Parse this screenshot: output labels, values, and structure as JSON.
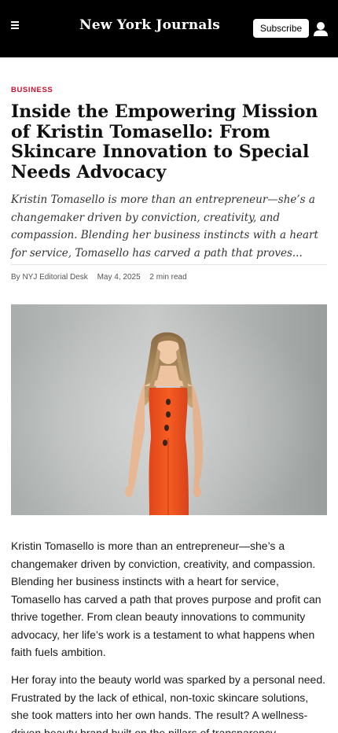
{
  "header": {
    "logo": "New York Journals",
    "subscribe_label": "Subscribe",
    "menu_icon": "hamburger-menu-icon",
    "user_icon": "user-icon"
  },
  "article": {
    "category": "BUSINESS",
    "headline": "Inside the Empowering Mission of Kristin Tomasello: From Skincare Innovation to Special Needs Advocacy",
    "dek": "Kristin Tomasello is more than an entrepreneur—she’s a changemaker driven by conviction, creativity, and compassion. Blending her business instincts with a heart for service, Tomasello has carved a path that proves...",
    "byline": "By NYJ Editorial Desk",
    "date": "May 4, 2025",
    "read_time": "2 min read",
    "paragraphs": [
      "Kristin Tomasello is more than an entrepreneur—she’s a changemaker driven by conviction, creativity, and compassion. Blending her business instincts with a heart for service, Tomasello has carved a path that proves purpose and profit can thrive together. From clean beauty innovations to community advocacy, her life’s work is a testament to what happens when faith fuels ambition.",
      "Her foray into the beauty world was sparked by a personal need. Frustrated by the lack of ethical, non-toxic skincare solutions, she took matters into her own hands. The result? A wellness-driven beauty brand built on the pillars of transparency, sustainability"
    ]
  },
  "colors": {
    "topbar": "#000000",
    "category": "#c8102e",
    "dress": "#f0551c",
    "backdrop": "#b8bbb9"
  }
}
